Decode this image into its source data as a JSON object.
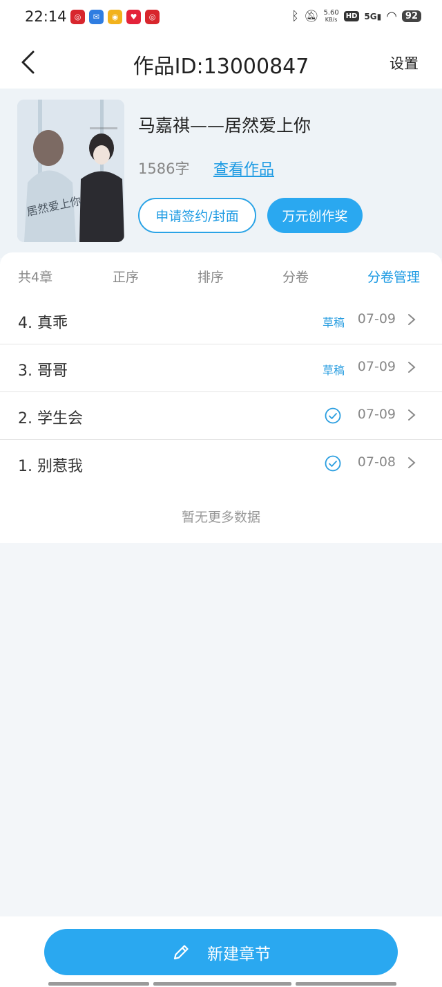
{
  "status_bar": {
    "time": "22:14",
    "net_speed_value": "5.60",
    "net_speed_unit": "KB/s",
    "hd": "HD",
    "signal": "5G",
    "battery": "92",
    "icons": [
      "netease-music-icon",
      "app-100-icon",
      "weibo-icon",
      "heart-app-icon",
      "netease-music-icon"
    ]
  },
  "nav": {
    "title": "作品ID:13000847",
    "settings": "设置"
  },
  "book": {
    "title": "马嘉祺——居然爱上你",
    "word_count": "1586字",
    "view_link": "查看作品",
    "sign_button": "申请签约/封面",
    "award_button": "万元创作奖"
  },
  "toolbar": {
    "count": "共4章",
    "ascending": "正序",
    "sort": "排序",
    "volume": "分卷",
    "volume_manage": "分卷管理"
  },
  "chapters": [
    {
      "title": "4. 真乖",
      "status": "草稿",
      "date": "07-09"
    },
    {
      "title": "3. 哥哥",
      "status": "草稿",
      "date": "07-09"
    },
    {
      "title": "2. 学生会",
      "status": "check",
      "date": "07-09"
    },
    {
      "title": "1. 别惹我",
      "status": "check",
      "date": "07-08"
    }
  ],
  "no_more": "暂无更多数据",
  "new_chapter": "新建章节",
  "colors": {
    "accent": "#2aa8f0",
    "link": "#1e9be3",
    "background": "#f3f6f9"
  }
}
